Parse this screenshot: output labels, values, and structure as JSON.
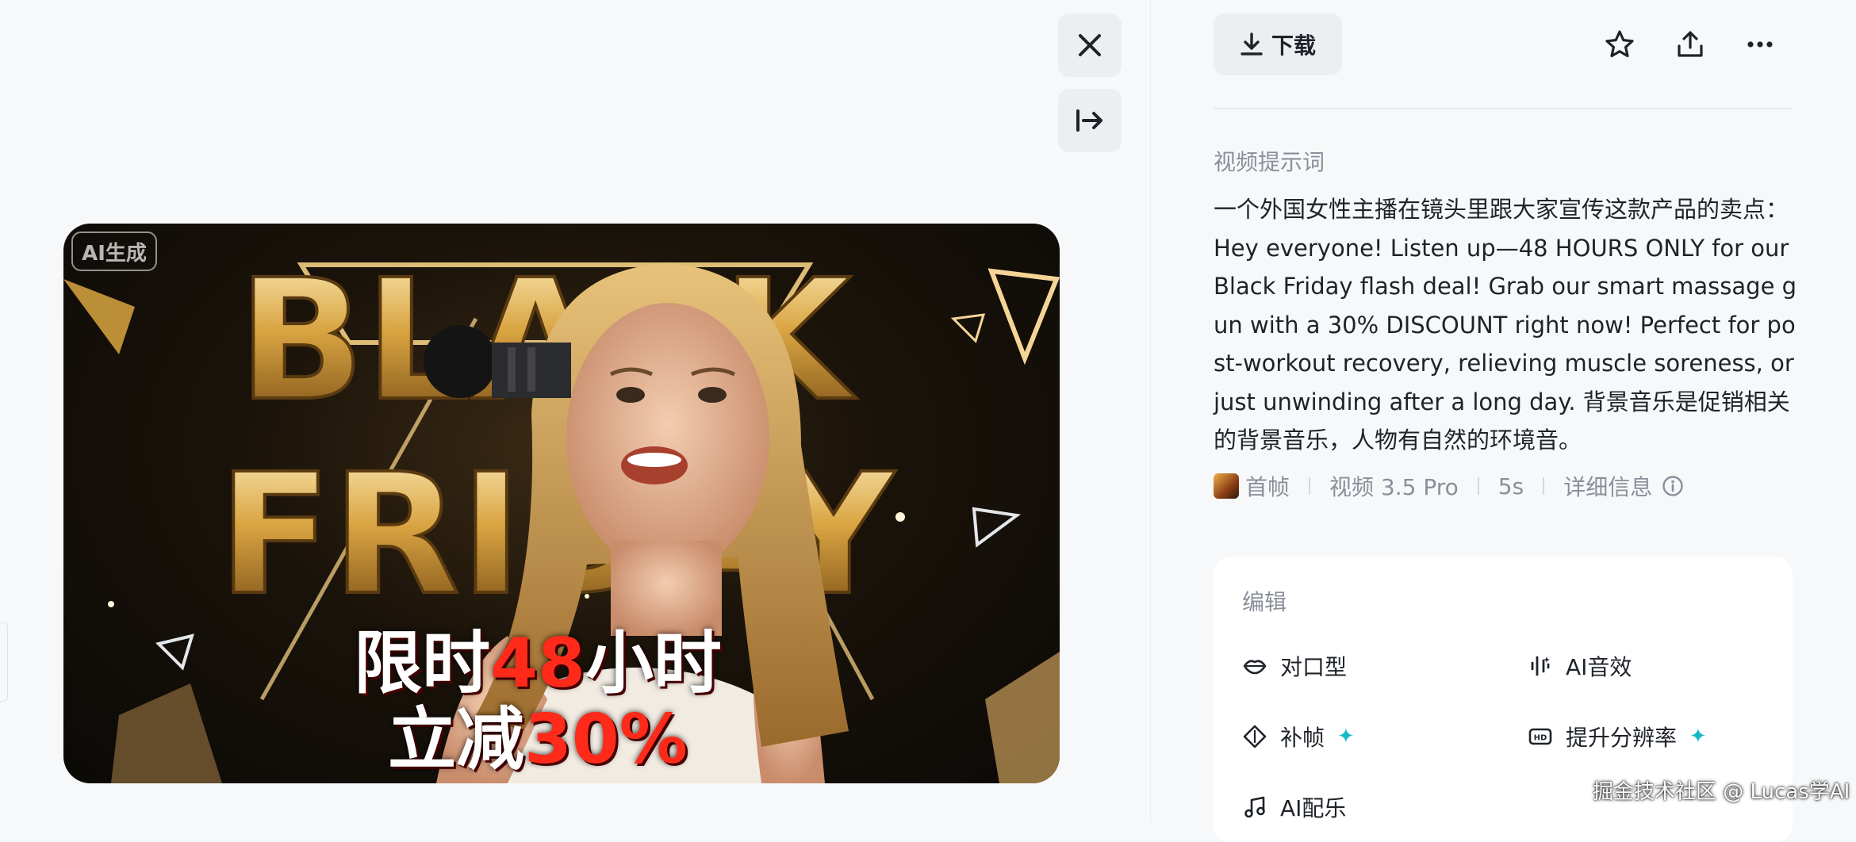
{
  "video": {
    "ai_badge": "AI生成",
    "overlay_line1_prefix": "限时",
    "overlay_line1_highlight": "48",
    "overlay_line1_suffix": "小时",
    "overlay_line2_prefix": "立减",
    "overlay_line2_highlight": "30%",
    "background_title_line1": "BLACK",
    "background_title_line2": "FRIDAY"
  },
  "controls": {
    "close_icon": "close-icon",
    "expand_icon": "collapse-right-icon"
  },
  "toolbar": {
    "download_label": "下载",
    "icons": [
      "download-icon",
      "star-icon",
      "share-icon",
      "more-icon"
    ]
  },
  "prompt": {
    "label": "视频提示词",
    "text": "一个外国女性主播在镜头里跟大家宣传这款产品的卖点：Hey everyone! Listen up—48 HOURS ONLY for our Black Friday flash deal! Grab our smart massage gun with a 30% DISCOUNT right now! Perfect for post-workout recovery, relieving muscle soreness, or just unwinding after a long day. 背景音乐是促销相关的背景音乐，人物有自然的环境音。"
  },
  "meta": {
    "first_frame": "首帧",
    "model": "视频 3.5 Pro",
    "duration": "5s",
    "details": "详细信息"
  },
  "edit": {
    "title": "编辑",
    "tools": {
      "lip_sync": "对口型",
      "ai_sound": "AI音效",
      "frame_interp": "补帧",
      "upscale": "提升分辨率",
      "ai_music": "AI配乐"
    }
  },
  "watermark": "掘金技术社区 @ Lucas学AI",
  "colors": {
    "accent_sparkle": "#17b8c9",
    "promo_red": "#ff2a1a",
    "gold": "#d9a441"
  }
}
